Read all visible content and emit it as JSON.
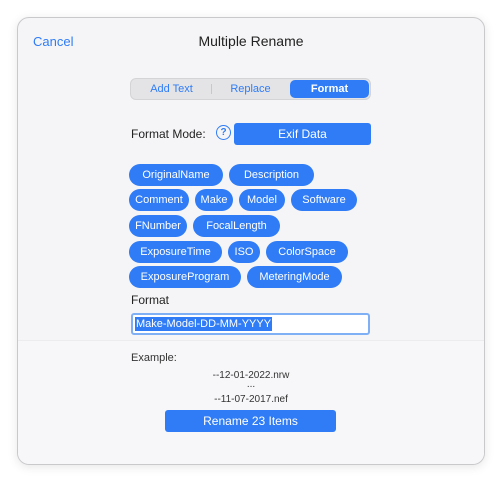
{
  "header": {
    "cancel_label": "Cancel",
    "title": "Multiple Rename"
  },
  "segments": [
    "Add Text",
    "Replace",
    "Format"
  ],
  "active_segment": "Format",
  "format_mode": {
    "label": "Format Mode:",
    "help_icon": "?",
    "value": "Exif Data"
  },
  "tags": [
    "OriginalName",
    "Description",
    "Comment",
    "Make",
    "Model",
    "Software",
    "FNumber",
    "FocalLength",
    "ExposureTime",
    "ISO",
    "ColorSpace",
    "ExposureProgram",
    "MeteringMode"
  ],
  "format": {
    "label": "Format",
    "value": "Make-Model-DD-MM-YYYY"
  },
  "example": {
    "label": "Example:",
    "lines": [
      "--12-01-2022.nrw",
      "...",
      "--11-07-2017.nef"
    ]
  },
  "rename_button": "Rename 23 Items",
  "colors": {
    "accent": "#2f7cf6",
    "background": "#f5f5f7"
  }
}
